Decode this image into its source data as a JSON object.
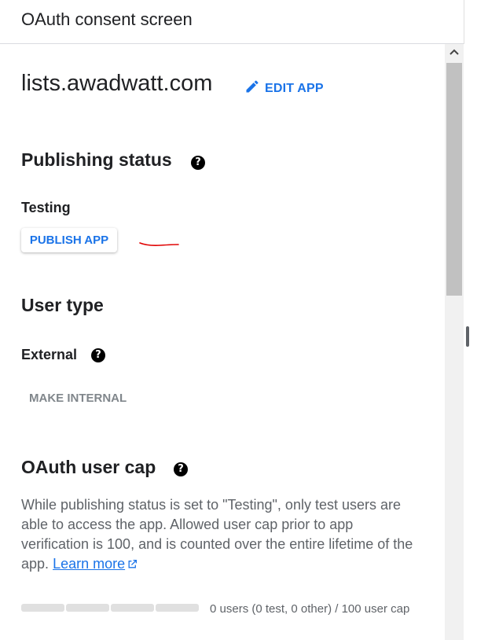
{
  "header": {
    "title": "OAuth consent screen"
  },
  "app": {
    "name": "lists.awadwatt.com",
    "edit_label": "EDIT APP"
  },
  "publishing": {
    "heading": "Publishing status",
    "status": "Testing",
    "publish_label": "PUBLISH APP"
  },
  "user_type": {
    "heading": "User type",
    "value": "External",
    "make_internal_label": "MAKE INTERNAL"
  },
  "user_cap": {
    "heading": "OAuth user cap",
    "description": "While publishing status is set to \"Testing\", only test users are able to access the app. Allowed user cap prior to app verification is 100, and is counted over the entire lifetime of the app.",
    "learn_more": "Learn more",
    "count_text": "0 users (0 test, 0 other) / 100 user cap",
    "used": 0,
    "limit": 100
  },
  "icons": {
    "edit": "pencil-icon",
    "help": "help-circle-icon",
    "external_link": "external-link-icon",
    "scroll_up": "chevron-up-icon"
  },
  "colors": {
    "accent": "#1a73e8",
    "annotation": "#e00000"
  }
}
